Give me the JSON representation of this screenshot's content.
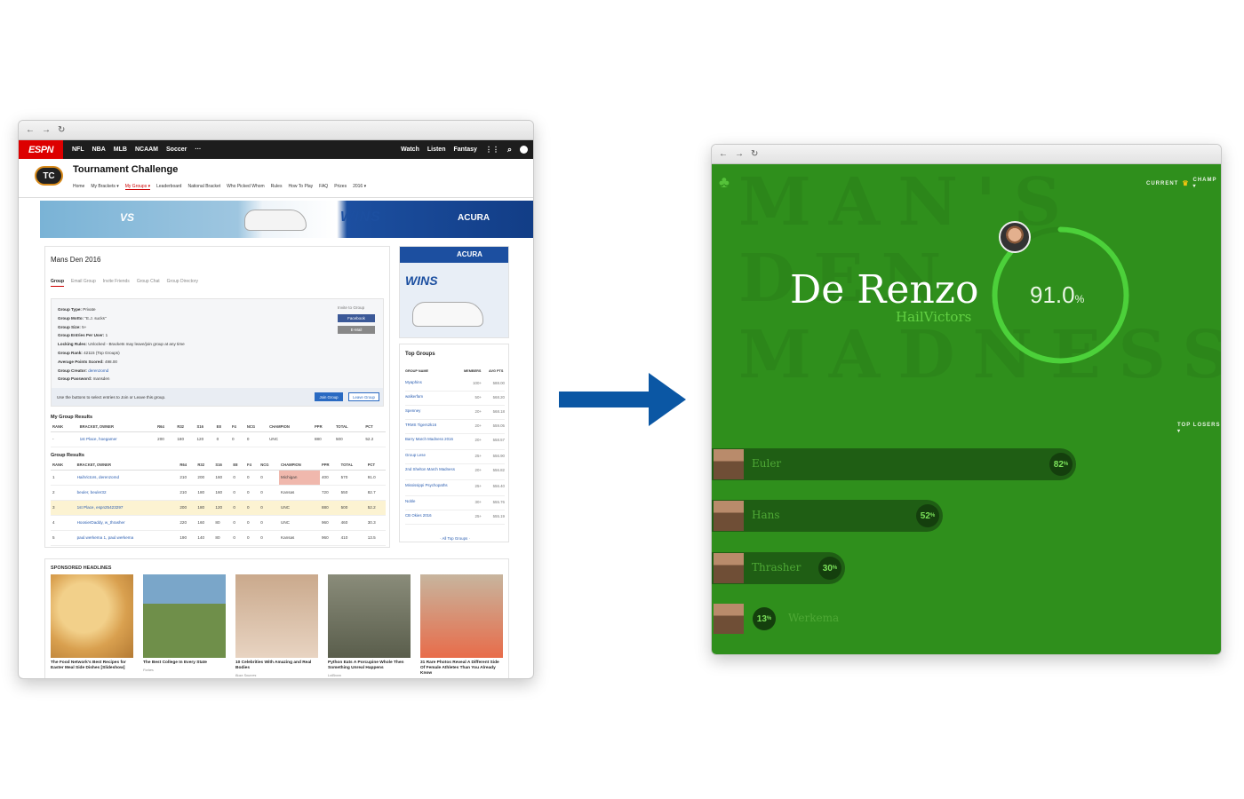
{
  "left": {
    "browser_controls": [
      "←",
      "→",
      "↻"
    ],
    "nav": {
      "logo": "ESPN",
      "links": [
        "NFL",
        "NBA",
        "MLB",
        "NCAAM",
        "Soccer",
        "···"
      ],
      "right_links": [
        "Watch",
        "Listen",
        "Fantasy"
      ]
    },
    "header": {
      "logo": "TC",
      "title": "Tournament Challenge",
      "subnav": [
        "Home",
        "My Brackets ▾",
        "My Groups ▾",
        "Leaderboard",
        "National Bracket",
        "Who Picked Whom",
        "Rules",
        "How To Play",
        "FAQ",
        "Prizes",
        "2016 ▾"
      ]
    },
    "banner": {
      "vs": "VS",
      "wins": "WINS",
      "brand": "ACURA"
    },
    "group": {
      "title": "Mans Den 2016",
      "tabs": [
        "Group",
        "Email Group",
        "Invite Friends",
        "Group Chat",
        "Group Directory"
      ],
      "info": [
        [
          "Group Type:",
          "Private"
        ],
        [
          "Group Motto:",
          "\"E.J. sucks\""
        ],
        [
          "Group Size:",
          "5+"
        ],
        [
          "Group Entries Per User:",
          "1"
        ],
        [
          "Locking Rules:",
          "Unlocked - Brackets may leave/join group at any time"
        ],
        [
          "Group Rank:",
          "42115 (Top Groups)"
        ],
        [
          "Average Points Scored:",
          "498.00"
        ],
        [
          "Group Creator:",
          "derenzomd"
        ],
        [
          "Group Password:",
          "mansden"
        ]
      ],
      "invite_label": "Invite to Group",
      "facebook": "Facebook",
      "email": "E-Mail",
      "join_text": "Use the buttons to select entries to Join or Leave this group.",
      "join": "Join Group",
      "leave": "Leave Group"
    },
    "my_results": {
      "title": "My Group Results",
      "headers": [
        "RANK",
        "BRACKET, OWNER",
        "R64",
        "R32",
        "S16",
        "E8",
        "F4",
        "NCG",
        "CHAMPION",
        "PPR",
        "TOTAL",
        "PCT"
      ],
      "rows": [
        [
          "-",
          "1st Place, hoegamer",
          "200",
          "180",
          "120",
          "0",
          "0",
          "0",
          "UNC",
          "880",
          "500",
          "52.2"
        ]
      ]
    },
    "group_results": {
      "title": "Group Results",
      "headers": [
        "RANK",
        "BRACKET, OWNER",
        "R64",
        "R32",
        "S16",
        "E8",
        "F4",
        "NCG",
        "CHAMPION",
        "PPR",
        "TOTAL",
        "PCT"
      ],
      "rows": [
        [
          "1",
          "HailVictors, derenzomd",
          "210",
          "200",
          "160",
          "0",
          "0",
          "0",
          "Michigan",
          "400",
          "570",
          "91.0"
        ],
        [
          "2",
          "beuler, beuler32",
          "210",
          "180",
          "160",
          "0",
          "0",
          "0",
          "Kansas",
          "720",
          "550",
          "82.7"
        ],
        [
          "3",
          "1st Place, espn25423297",
          "200",
          "180",
          "120",
          "0",
          "0",
          "0",
          "UNC",
          "880",
          "500",
          "52.2"
        ],
        [
          "4",
          "HoosierDaddy, w_thrasher",
          "220",
          "160",
          "80",
          "0",
          "0",
          "0",
          "UNC",
          "960",
          "460",
          "30.3"
        ],
        [
          "5",
          "paul.werkema 1, paul.werkema",
          "190",
          "140",
          "80",
          "0",
          "0",
          "0",
          "Kansas",
          "960",
          "410",
          "13.5"
        ]
      ]
    },
    "ad": {
      "brand": "ACURA",
      "wins": "WINS"
    },
    "top_groups": {
      "title": "Top Groups",
      "headers": [
        "GROUP NAME",
        "MEMBERS",
        "AVG PTS"
      ],
      "rows": [
        [
          "Myaphins",
          "100+",
          "588.00"
        ],
        [
          "walkerfam",
          "50+",
          "568.20"
        ],
        [
          "Spenney",
          "20+",
          "568.18"
        ],
        [
          "TRMS Tigers2k16",
          "20+",
          "559.05"
        ],
        [
          "Barry March Madness 2016",
          "20+",
          "558.57"
        ],
        [
          "Group Lese",
          "25+",
          "556.90"
        ],
        [
          "2nd Shelton March Madness",
          "20+",
          "556.82"
        ],
        [
          "Mississippi Psychopaths",
          "25+",
          "556.40"
        ],
        [
          "Noble",
          "30+",
          "555.76"
        ],
        [
          "CB Okies 2016",
          "25+",
          "555.19"
        ]
      ],
      "all": "· All Top Groups ·"
    },
    "sponsored": {
      "title": "SPONSORED HEADLINES",
      "items": [
        {
          "caption": "The Food Network's Best Recipes for Easter Meal Side Dishes [Slideshow]",
          "source": ""
        },
        {
          "caption": "The Best College In Every State",
          "source": "Forbes"
        },
        {
          "caption": "10 Celebrities With Amazing and Real Bodies",
          "source": "Buzz Sources"
        },
        {
          "caption": "Python Eats A Porcupine Whole Then Something Unreal Happens",
          "source": "LolBoom"
        },
        {
          "caption": "31 Rare Photos Reveal A Different Side Of Female Athletes Than You Already Know",
          "source": ""
        }
      ]
    }
  },
  "right": {
    "browser_controls": [
      "←",
      "→",
      "↻"
    ],
    "background_text": "MAN'S DEN MADNESS",
    "menu": {
      "current": "CURRENT",
      "champ": "CHAMP ▾"
    },
    "leader": {
      "name": "De Renzo",
      "username": "HailVictors",
      "pct": "91.0",
      "pct_unit": "%",
      "ring_fraction": 0.91
    },
    "losers_label": "TOP LOSERS ▾",
    "losers": [
      {
        "name": "Euler",
        "pct": "82",
        "unit": "%",
        "fraction": 0.82
      },
      {
        "name": "Hans",
        "pct": "52",
        "unit": "%",
        "fraction": 0.52
      },
      {
        "name": "Thrasher",
        "pct": "30",
        "unit": "%",
        "fraction": 0.3
      },
      {
        "name": "Werkema",
        "pct": "13",
        "unit": "%",
        "fraction": 0.13
      }
    ],
    "colors": {
      "background": "#2f8f1c",
      "ring": "#4cd13a",
      "bar": "#1f5e14",
      "name": "#ffffff",
      "username": "#62d043"
    }
  },
  "arrow_color": "#0b57a4"
}
